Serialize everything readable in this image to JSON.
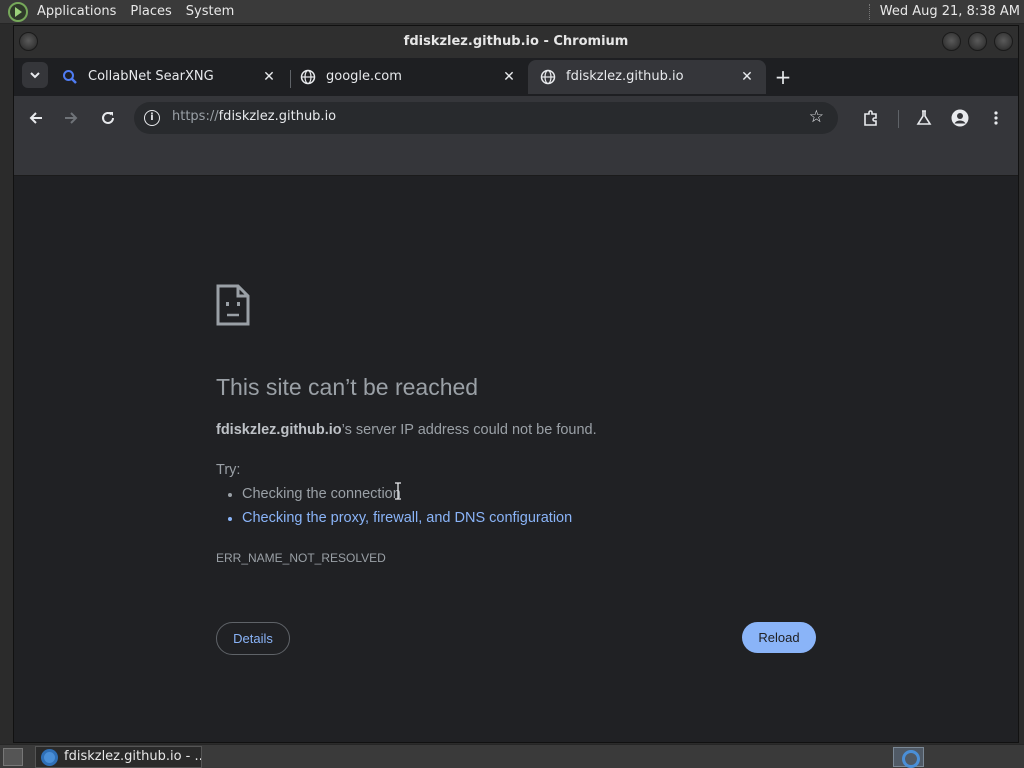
{
  "top_panel": {
    "menus": [
      "Applications",
      "Places",
      "System"
    ],
    "clock": "Wed Aug 21,  8:38 AM"
  },
  "window": {
    "title": "fdiskzlez.github.io - Chromium"
  },
  "tabs": [
    {
      "label": "CollabNet SearXNG",
      "icon": "search-icon",
      "active": false
    },
    {
      "label": "google.com",
      "icon": "globe-icon",
      "active": false
    },
    {
      "label": "fdiskzlez.github.io",
      "icon": "globe-icon",
      "active": true
    }
  ],
  "toolbar": {
    "url_scheme": "https://",
    "url_host": "fdiskzlez.github.io"
  },
  "error_page": {
    "heading": "This site can’t be reached",
    "host": "fdiskzlez.github.io",
    "summary_rest": "’s server IP address could not be found.",
    "try_label": "Try:",
    "suggestions": [
      "Checking the connection",
      "Checking the proxy, firewall, and DNS configuration"
    ],
    "error_code": "ERR_NAME_NOT_RESOLVED",
    "details_label": "Details",
    "reload_label": "Reload"
  },
  "taskbar": {
    "task_label": "fdiskzlez.github.io - ..."
  },
  "colors": {
    "accent": "#8ab4f8",
    "page_bg": "#202124",
    "toolbar_bg": "#35363a"
  }
}
